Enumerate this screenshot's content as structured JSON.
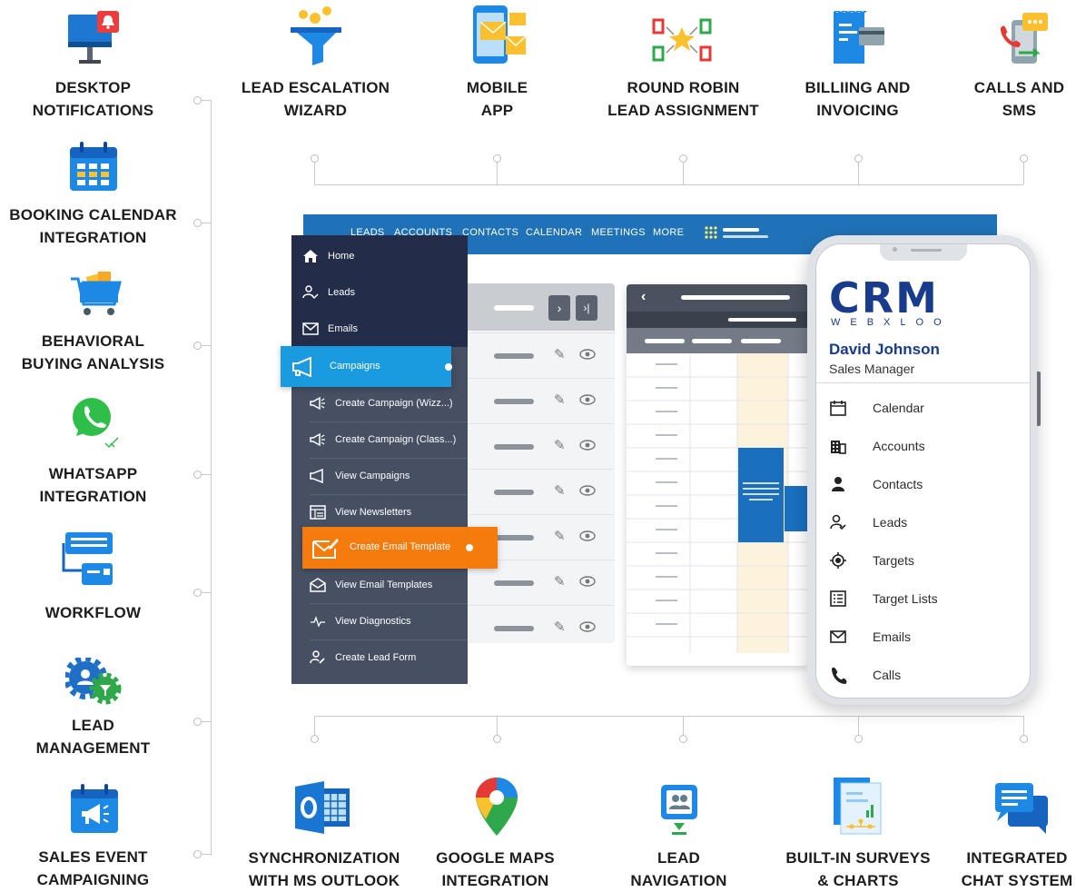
{
  "features_left": [
    {
      "line1": "DESKTOP",
      "line2": "NOTIFICATIONS",
      "icon": "desktop-notification-icon"
    },
    {
      "line1": "BOOKING CALENDAR",
      "line2": "INTEGRATION",
      "icon": "calendar-icon"
    },
    {
      "line1": "BEHAVIORAL",
      "line2": "BUYING ANALYSIS",
      "icon": "shopping-cart-icon"
    },
    {
      "line1": "WHATSAPP",
      "line2": "INTEGRATION",
      "icon": "whatsapp-icon"
    },
    {
      "line1": "WORKFLOW",
      "line2": "",
      "icon": "workflow-icon"
    },
    {
      "line1": "LEAD",
      "line2": "MANAGEMENT",
      "icon": "gears-icon"
    },
    {
      "line1": "SALES EVENT",
      "line2": "CAMPAIGNING",
      "icon": "megaphone-calendar-icon"
    }
  ],
  "features_top": [
    {
      "line1": "LEAD ESCALATION",
      "line2": "WIZARD",
      "icon": "funnel-icon"
    },
    {
      "line1": "MOBILE",
      "line2": "APP",
      "icon": "mobile-envelope-icon"
    },
    {
      "line1": "ROUND ROBIN",
      "line2": "LEAD ASSIGNMENT",
      "icon": "round-robin-icon"
    },
    {
      "line1": "BILLIING AND",
      "line2": "INVOICING",
      "icon": "invoice-icon"
    },
    {
      "line1": "CALLS AND",
      "line2": "SMS",
      "icon": "phone-sms-icon"
    }
  ],
  "features_bottom": [
    {
      "line1": "SYNCHRONIZATION",
      "line2": "WITH MS OUTLOOK",
      "icon": "outlook-icon"
    },
    {
      "line1": "GOOGLE MAPS",
      "line2": "INTEGRATION",
      "icon": "map-pin-icon"
    },
    {
      "line1": "LEAD",
      "line2": "NAVIGATION",
      "icon": "lead-navigation-icon"
    },
    {
      "line1": "BUILT-IN SURVEYS",
      "line2": "& CHARTS",
      "icon": "survey-chart-icon"
    },
    {
      "line1": "INTEGRATED",
      "line2": "CHAT SYSTEM",
      "icon": "chat-icon"
    }
  ],
  "topbar": {
    "nav": [
      "LEADS",
      "ACCOUNTS",
      "CONTACTS",
      "CALENDAR",
      "MEETINGS",
      "MORE"
    ],
    "color": "#1f72b7"
  },
  "sidebar": {
    "items": [
      {
        "label": "Home",
        "icon": "home-icon"
      },
      {
        "label": "Leads",
        "icon": "lead-user-icon"
      },
      {
        "label": "Emails",
        "icon": "envelope-icon"
      },
      {
        "label": "Campaigns",
        "icon": "megaphone-icon"
      },
      {
        "label": "Create Campaign (Wizz...)",
        "icon": "megaphone-add-icon"
      },
      {
        "label": "Create Campaign (Class...)",
        "icon": "megaphone-add-icon"
      },
      {
        "label": "View Campaigns",
        "icon": "megaphone-icon"
      },
      {
        "label": "View Newsletters",
        "icon": "newsletter-icon"
      },
      {
        "label": "Create Email Template",
        "icon": "envelope-edit-icon"
      },
      {
        "label": "View Email Templates",
        "icon": "open-envelope-icon"
      },
      {
        "label": "View Diagnostics",
        "icon": "pulse-icon"
      },
      {
        "label": "Create Lead Form",
        "icon": "lead-form-icon"
      }
    ],
    "accent_blue": "#1a9be0",
    "accent_orange": "#f57b0d"
  },
  "phone": {
    "logo": "CRM",
    "logo_sub": "WEBXLOO",
    "user_name": "David Johnson",
    "user_role": "Sales Manager",
    "menu": [
      {
        "label": "Calendar",
        "icon": "calendar-icon"
      },
      {
        "label": "Accounts",
        "icon": "building-icon"
      },
      {
        "label": "Contacts",
        "icon": "person-icon"
      },
      {
        "label": "Leads",
        "icon": "lead-user-icon"
      },
      {
        "label": "Targets",
        "icon": "target-icon"
      },
      {
        "label": "Target Lists",
        "icon": "list-icon"
      },
      {
        "label": "Emails",
        "icon": "envelope-icon"
      },
      {
        "label": "Calls",
        "icon": "phone-icon"
      }
    ]
  }
}
